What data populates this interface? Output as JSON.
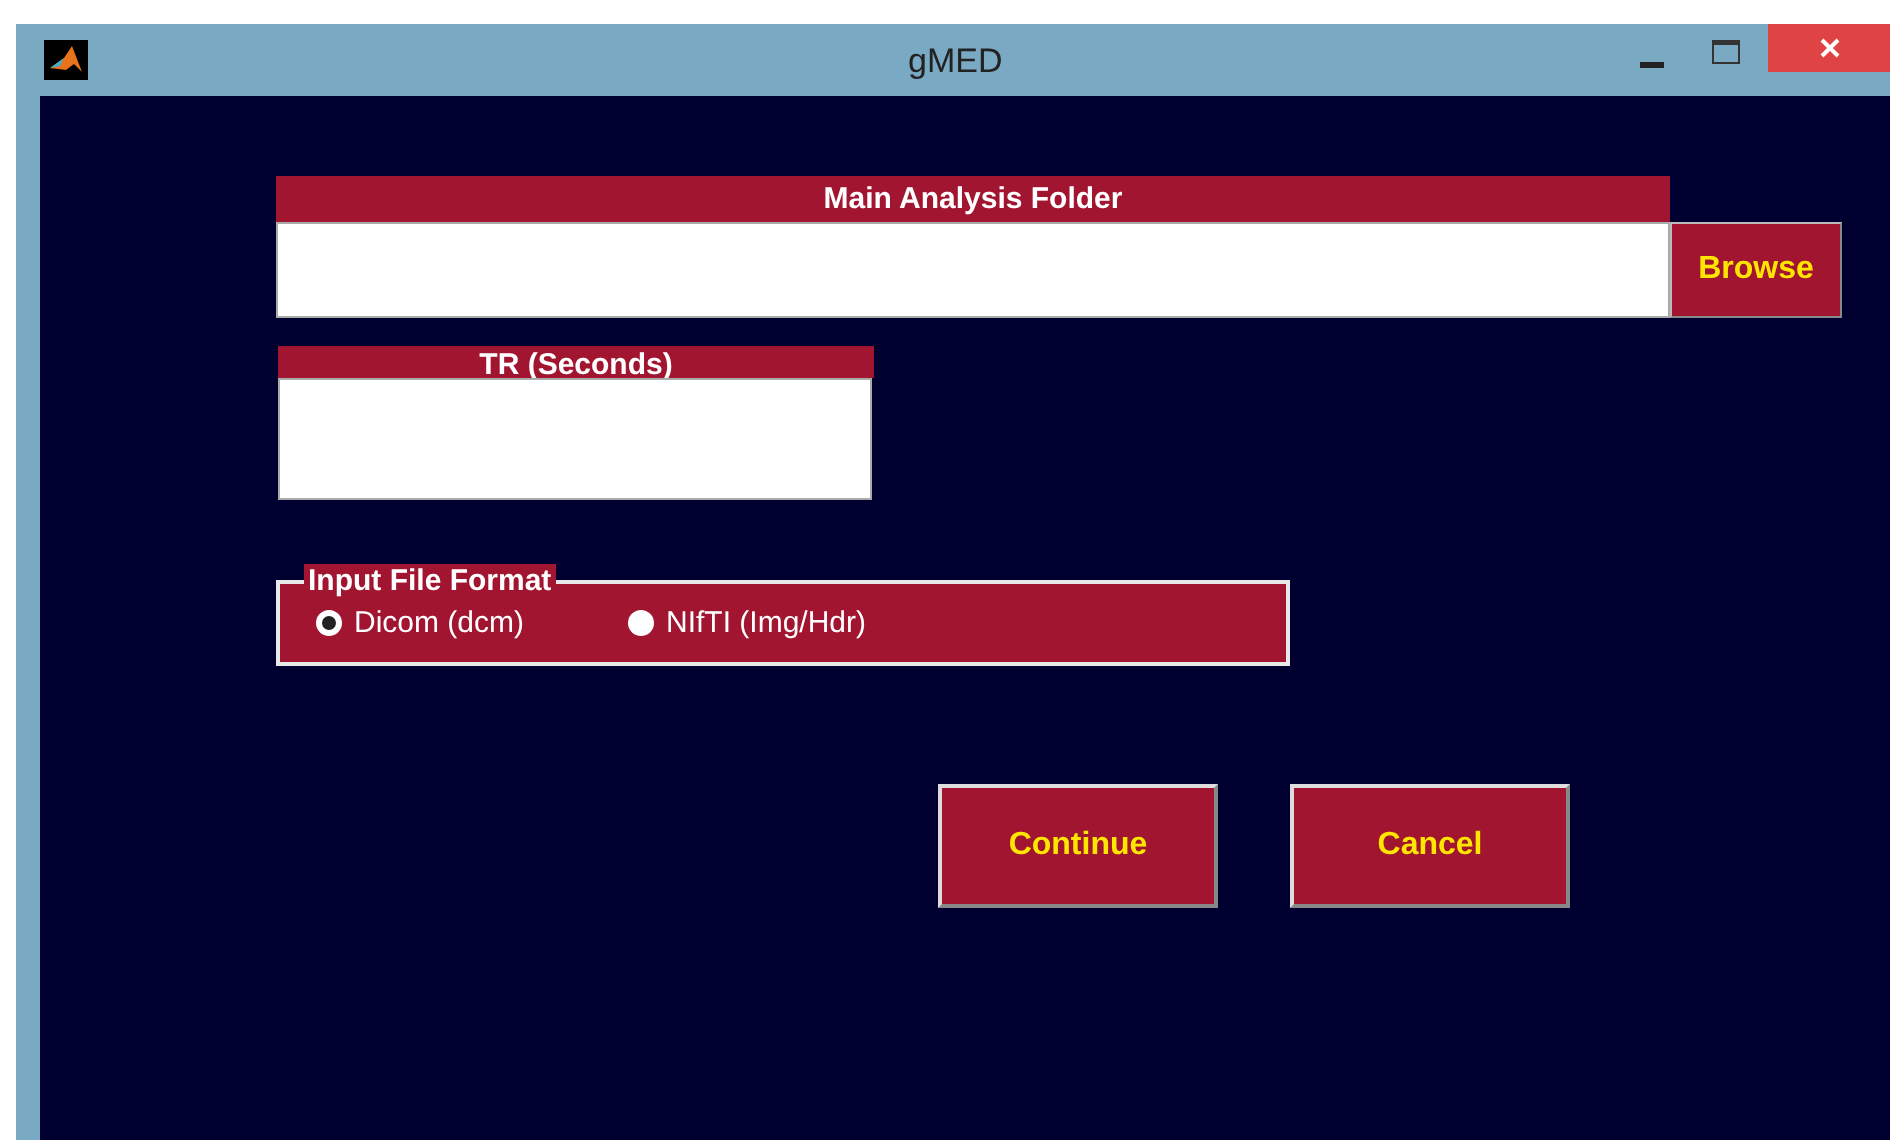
{
  "window": {
    "title": "gMED"
  },
  "folder": {
    "label": "Main Analysis Folder",
    "button": "Browse"
  },
  "tr": {
    "label": "TR (Seconds)"
  },
  "input_format": {
    "legend": "Input File Format",
    "options": [
      {
        "label": "Dicom (dcm)",
        "selected": true
      },
      {
        "label": "NIfTI (Img/Hdr)",
        "selected": false
      }
    ]
  },
  "buttons": [
    "Continue",
    "Cancel"
  ]
}
